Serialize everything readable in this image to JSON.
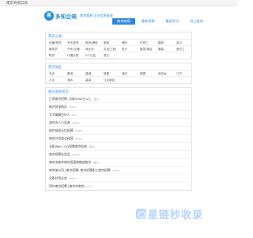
{
  "topbar": {
    "text": "南京商易云商"
  },
  "header": {
    "logo_mark": "易",
    "logo_text": "多知企晓",
    "logo_sub": "南京商易 企业信息查询"
  },
  "nav": [
    {
      "label": "南京商易"
    },
    {
      "label": "最新招聘"
    },
    {
      "label": "最新资讯"
    },
    {
      "label": "网上查询"
    }
  ],
  "sections": {
    "industry": {
      "title": "南京分类",
      "items": [
        "运输/物流",
        "专业咨询",
        "电信/通信",
        "家政",
        "通讯",
        "外贸工",
        "翻译",
        "会计",
        "服务员",
        "汽车/交通",
        "商业化",
        "文化/工程",
        "设计",
        "美发/美容",
        "服装",
        "其它工",
        "职员",
        "代理分类",
        "ICT认证",
        "其它"
      ]
    },
    "districts": {
      "title": "南京地区",
      "items": [
        "玄武",
        "秦淮",
        "建邺",
        "鼓楼",
        "浦口",
        "栖霞",
        "雨花台",
        "江宁",
        "六合",
        "溧水",
        "高淳",
        "江北新区"
      ]
    },
    "companies": {
      "title": "南京商易资讯",
      "items": [
        {
          "name": "正得南京招聘 ,月收4000元以上",
          "tag": "(面议)"
        },
        {
          "name": "新外贸采购员",
          "tag": "(5000)"
        },
        {
          "name": "文字编辑合伙人",
          "tag": "(6k)"
        },
        {
          "name": "南京市人力资源",
          "tag": "(4000)"
        },
        {
          "name": "南京前程无忧招聘",
          "tag": "(4000)"
        },
        {
          "name": "南京外贸商业经营",
          "tag": "(5000)"
        },
        {
          "name": "全职Wall / QQ招聘南京机构",
          "tag": "(面议)"
        },
        {
          "name": "南京招聘业务员",
          "tag": "(4000)"
        },
        {
          "name": "南京市南京南京招募销售部南京",
          "tag": "(面议)"
        },
        {
          "name": "南京某公司 (南京招聘) 南京招聘职工南京招聘",
          "tag": "(4500)"
        },
        {
          "name": "全职外贸业务",
          "tag": "(5000)"
        },
        {
          "name": "同外南京招聘 (南京市南京)",
          "tag": "(4k)"
        }
      ]
    }
  },
  "watermark": {
    "text": "星链秒收录"
  },
  "colors": {
    "accent": "#2f86e0",
    "watermark": "#4096ff"
  }
}
